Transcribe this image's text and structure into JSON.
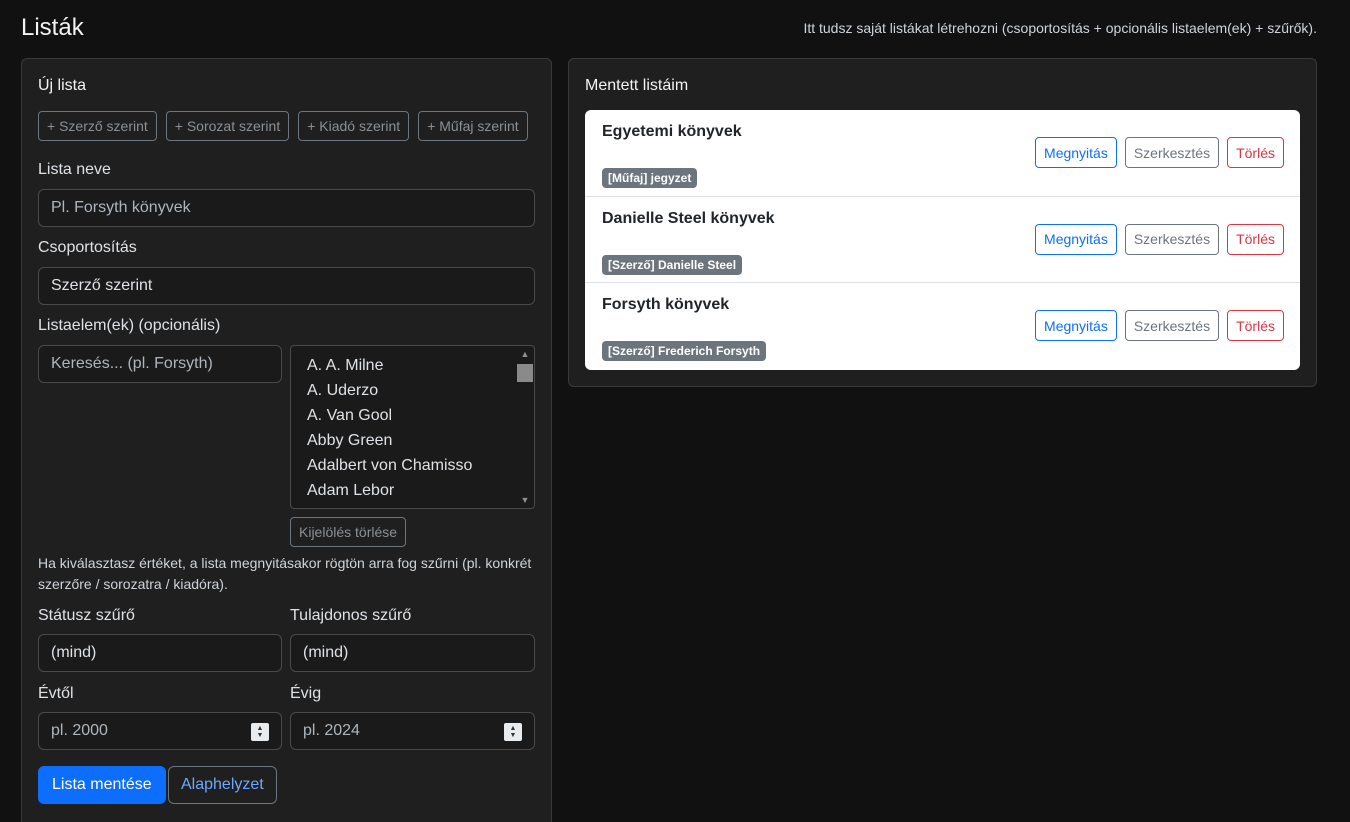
{
  "header": {
    "title": "Listák",
    "hint": "Itt tudsz saját listákat létrehozni (csoportosítás + opcionális listaelem(ek) + szűrők)."
  },
  "new_list": {
    "title": "Új lista",
    "quick_chips": [
      "+ Szerző szerint",
      "+ Sorozat szerint",
      "+ Kiadó szerint",
      "+ Műfaj szerint"
    ],
    "name_label": "Lista neve",
    "name_placeholder": "Pl. Forsyth könyvek",
    "grouping_label": "Csoportosítás",
    "grouping_value": "Szerző szerint",
    "items_label": "Listaelem(ek) (opcionális)",
    "search_placeholder": "Keresés... (pl. Forsyth)",
    "listbox_items": [
      "A. A. Milne",
      "A. Uderzo",
      "A. Van Gool",
      "Abby Green",
      "Adalbert von Chamisso",
      "Adam Lebor"
    ],
    "clear_selection": "Kijelölés törlése",
    "help": "Ha kiválasztasz értéket, a lista megnyitásakor rögtön arra fog szűrni (pl. konkrét szerzőre / sorozatra / kiadóra).",
    "status_label": "Státusz szűrő",
    "status_value": "(mind)",
    "owner_label": "Tulajdonos szűrő",
    "owner_value": "(mind)",
    "year_from_label": "Évtől",
    "year_from_placeholder": "pl. 2000",
    "year_to_label": "Évig",
    "year_to_placeholder": "pl. 2024",
    "save_button": "Lista mentése",
    "reset_button": "Alaphelyzet"
  },
  "saved_lists": {
    "title": "Mentett listáim",
    "items": [
      {
        "name": "Egyetemi könyvek",
        "badge": "[Műfaj] jegyzet"
      },
      {
        "name": "Danielle Steel könyvek",
        "badge": "[Szerző] Danielle Steel"
      },
      {
        "name": "Forsyth könyvek",
        "badge": "[Szerző] Frederich Forsyth"
      }
    ],
    "actions": {
      "open": "Megnyitás",
      "edit": "Szerkesztés",
      "delete": "Törlés"
    }
  }
}
